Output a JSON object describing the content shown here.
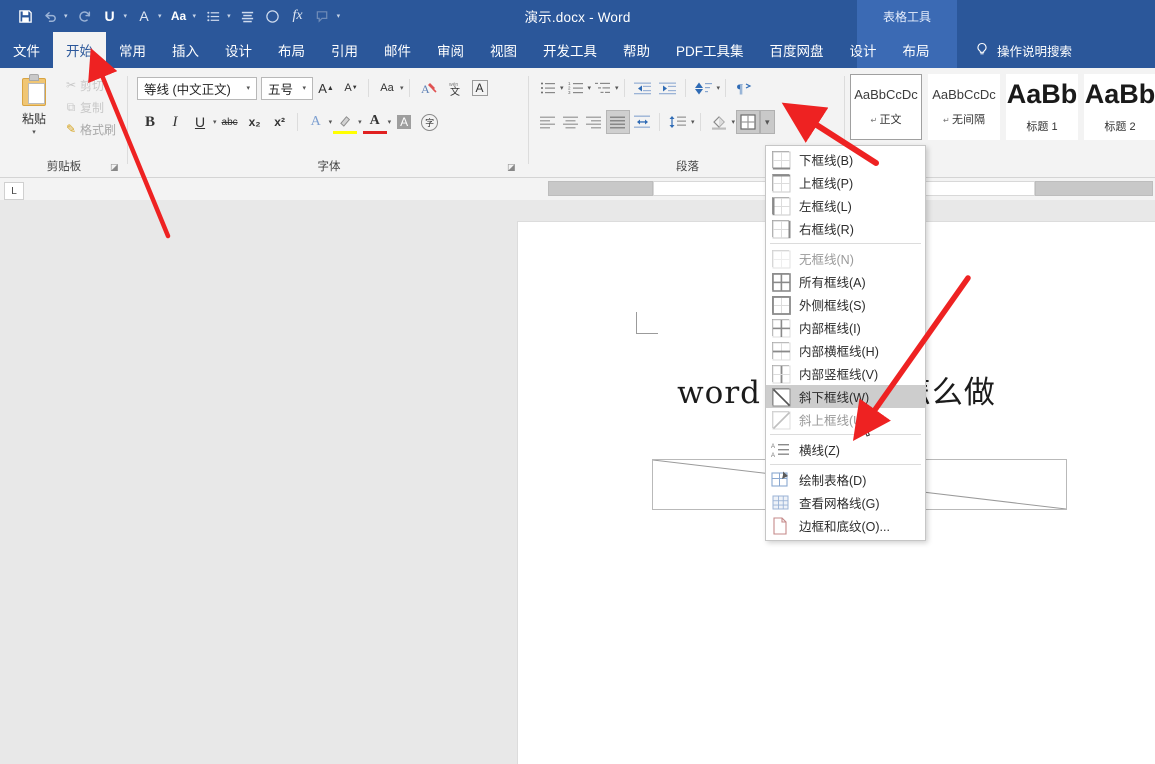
{
  "titlebar": {
    "document_title": "演示.docx  -  Word",
    "contextual_group": "表格工具",
    "quick_access": [
      {
        "name": "save-icon",
        "glyph": "▣"
      },
      {
        "name": "undo-icon",
        "glyph": "↶"
      },
      {
        "name": "redo-icon",
        "glyph": "↻"
      },
      {
        "name": "underline-icon",
        "glyph": "U"
      },
      {
        "name": "font-color-icon",
        "glyph": "A"
      },
      {
        "name": "change-case-icon",
        "glyph": "Aa"
      },
      {
        "name": "bullet-list-icon",
        "glyph": "☰"
      },
      {
        "name": "align-icon",
        "glyph": "≡"
      },
      {
        "name": "shape-circle-icon",
        "glyph": "○"
      },
      {
        "name": "formula-icon",
        "glyph": "fx"
      },
      {
        "name": "comment-icon",
        "glyph": "⬚"
      },
      {
        "name": "customize-qat-icon",
        "glyph": "▾"
      }
    ]
  },
  "tabs": [
    {
      "label": "文件",
      "active": false
    },
    {
      "label": "开始",
      "active": true
    },
    {
      "label": "常用",
      "active": false
    },
    {
      "label": "插入",
      "active": false
    },
    {
      "label": "设计",
      "active": false
    },
    {
      "label": "布局",
      "active": false
    },
    {
      "label": "引用",
      "active": false
    },
    {
      "label": "邮件",
      "active": false
    },
    {
      "label": "审阅",
      "active": false
    },
    {
      "label": "视图",
      "active": false
    },
    {
      "label": "开发工具",
      "active": false
    },
    {
      "label": "帮助",
      "active": false
    },
    {
      "label": "PDF工具集",
      "active": false
    },
    {
      "label": "百度网盘",
      "active": false
    }
  ],
  "contextual_tabs": [
    {
      "label": "设计"
    },
    {
      "label": "布局"
    }
  ],
  "tell_me": "操作说明搜索",
  "ribbon": {
    "clipboard": {
      "group_label": "剪贴板",
      "paste_label": "粘贴",
      "cut_label": "剪切",
      "copy_label": "复制",
      "format_painter_label": "格式刷"
    },
    "font": {
      "group_label": "字体",
      "font_name": "等线 (中文正文)",
      "font_size": "五号",
      "grow_font": "A",
      "shrink_font": "A",
      "change_case": "Aa",
      "clear_format": "A",
      "phonetic_guide": "文",
      "char_border": "A",
      "bold": "B",
      "italic": "I",
      "underline": "U",
      "strikethrough": "abc",
      "subscript": "x₂",
      "superscript": "x²",
      "text_effects": "A",
      "highlight": "✐",
      "font_color": "A",
      "char_shading": "A",
      "enclose_char": "字"
    },
    "paragraph": {
      "group_label": "段落",
      "bullets": "☰",
      "numbering": "☰",
      "multilevel": "☰",
      "decrease_indent": "←",
      "increase_indent": "→",
      "sort": "↓",
      "show_marks": "¶",
      "align_left": "≡",
      "align_center": "≡",
      "align_right": "≡",
      "justify": "≡",
      "distribute": "↔",
      "line_spacing": "↕",
      "shading": "△",
      "borders": "⊞"
    },
    "styles": [
      {
        "sample": "AaBbCcDc",
        "name": "正文",
        "selected": true,
        "size": "normal"
      },
      {
        "sample": "AaBbCcDc",
        "name": "无间隔",
        "selected": false,
        "size": "normal"
      },
      {
        "sample": "AaBb",
        "name": "标题 1",
        "selected": false,
        "size": "big"
      },
      {
        "sample": "AaBb",
        "name": "标题 2",
        "selected": false,
        "size": "big2"
      }
    ]
  },
  "borders_menu": {
    "items": [
      {
        "label": "下框线(B)",
        "icon": "border-bottom-icon",
        "state": "normal"
      },
      {
        "label": "上框线(P)",
        "icon": "border-top-icon",
        "state": "normal"
      },
      {
        "label": "左框线(L)",
        "icon": "border-left-icon",
        "state": "normal"
      },
      {
        "label": "右框线(R)",
        "icon": "border-right-icon",
        "state": "normal"
      },
      {
        "separator": true
      },
      {
        "label": "无框线(N)",
        "icon": "border-none-icon",
        "state": "dim"
      },
      {
        "label": "所有框线(A)",
        "icon": "border-all-icon",
        "state": "normal"
      },
      {
        "label": "外侧框线(S)",
        "icon": "border-outside-icon",
        "state": "normal"
      },
      {
        "label": "内部框线(I)",
        "icon": "border-inside-icon",
        "state": "normal"
      },
      {
        "label": "内部横框线(H)",
        "icon": "border-inside-horizontal-icon",
        "state": "normal"
      },
      {
        "label": "内部竖框线(V)",
        "icon": "border-inside-vertical-icon",
        "state": "normal"
      },
      {
        "label": "斜下框线(W)",
        "icon": "border-diagonal-down-icon",
        "state": "highlighted"
      },
      {
        "label": "斜上框线(U)",
        "icon": "border-diagonal-up-icon",
        "state": "dim"
      },
      {
        "separator": true
      },
      {
        "label": "横线(Z)",
        "icon": "horizontal-line-icon",
        "state": "normal"
      },
      {
        "separator": true
      },
      {
        "label": "绘制表格(D)",
        "icon": "draw-table-icon",
        "state": "normal"
      },
      {
        "label": "查看网格线(G)",
        "icon": "view-gridlines-icon",
        "state": "normal"
      },
      {
        "label": "边框和底纹(O)...",
        "icon": "borders-and-shading-icon",
        "state": "normal"
      }
    ]
  },
  "document": {
    "title_text": "word 表格斜线怎么做",
    "table_has_diagonal": true
  },
  "colors": {
    "ribbon_blue": "#2b579a",
    "contextual_blue": "#3b6ab4",
    "ribbon_body": "#f3f3f3",
    "canvas_grey": "#e8e8e8",
    "annotation_red": "#ee2222",
    "menu_highlight": "#cdcdcd"
  },
  "annotations": [
    {
      "name": "arrow-to-home-tab",
      "color": "#ee2222"
    },
    {
      "name": "arrow-to-borders-dropdown",
      "color": "#ee2222"
    },
    {
      "name": "arrow-to-diagonal-down-border",
      "color": "#ee2222"
    }
  ]
}
